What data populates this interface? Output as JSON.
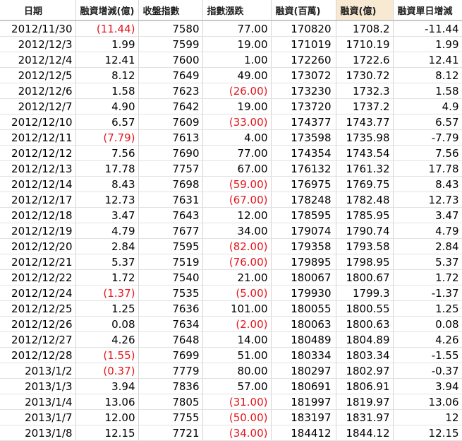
{
  "colors": {
    "negative": "#e4161c",
    "highlight_header": "#f7e9d2"
  },
  "table": {
    "headers": [
      "日期",
      "融資增減(億)",
      "收盤指數",
      "指數漲跌",
      "融資(百萬)",
      "融資(億)",
      "融資單日增減"
    ],
    "rows": [
      [
        "2012/11/30",
        "(11.44)",
        "7580",
        "77.00",
        "170820",
        "1708.2",
        "-11.44"
      ],
      [
        "2012/12/3",
        "1.99",
        "7599",
        "19.00",
        "171019",
        "1710.19",
        "1.99"
      ],
      [
        "2012/12/4",
        "12.41",
        "7600",
        "1.00",
        "172260",
        "1722.6",
        "12.41"
      ],
      [
        "2012/12/5",
        "8.12",
        "7649",
        "49.00",
        "173072",
        "1730.72",
        "8.12"
      ],
      [
        "2012/12/6",
        "1.58",
        "7623",
        "(26.00)",
        "173230",
        "1732.3",
        "1.58"
      ],
      [
        "2012/12/7",
        "4.90",
        "7642",
        "19.00",
        "173720",
        "1737.2",
        "4.9"
      ],
      [
        "2012/12/10",
        "6.57",
        "7609",
        "(33.00)",
        "174377",
        "1743.77",
        "6.57"
      ],
      [
        "2012/12/11",
        "(7.79)",
        "7613",
        "4.00",
        "173598",
        "1735.98",
        "-7.79"
      ],
      [
        "2012/12/12",
        "7.56",
        "7690",
        "77.00",
        "174354",
        "1743.54",
        "7.56"
      ],
      [
        "2012/12/13",
        "17.78",
        "7757",
        "67.00",
        "176132",
        "1761.32",
        "17.78"
      ],
      [
        "2012/12/14",
        "8.43",
        "7698",
        "(59.00)",
        "176975",
        "1769.75",
        "8.43"
      ],
      [
        "2012/12/17",
        "12.73",
        "7631",
        "(67.00)",
        "178248",
        "1782.48",
        "12.73"
      ],
      [
        "2012/12/18",
        "3.47",
        "7643",
        "12.00",
        "178595",
        "1785.95",
        "3.47"
      ],
      [
        "2012/12/19",
        "4.79",
        "7677",
        "34.00",
        "179074",
        "1790.74",
        "4.79"
      ],
      [
        "2012/12/20",
        "2.84",
        "7595",
        "(82.00)",
        "179358",
        "1793.58",
        "2.84"
      ],
      [
        "2012/12/21",
        "5.37",
        "7519",
        "(76.00)",
        "179895",
        "1798.95",
        "5.37"
      ],
      [
        "2012/12/22",
        "1.72",
        "7540",
        "21.00",
        "180067",
        "1800.67",
        "1.72"
      ],
      [
        "2012/12/24",
        "(1.37)",
        "7535",
        "(5.00)",
        "179930",
        "1799.3",
        "-1.37"
      ],
      [
        "2012/12/25",
        "1.25",
        "7636",
        "101.00",
        "180055",
        "1800.55",
        "1.25"
      ],
      [
        "2012/12/26",
        "0.08",
        "7634",
        "(2.00)",
        "180063",
        "1800.63",
        "0.08"
      ],
      [
        "2012/12/27",
        "4.26",
        "7648",
        "14.00",
        "180489",
        "1804.89",
        "4.26"
      ],
      [
        "2012/12/28",
        "(1.55)",
        "7699",
        "51.00",
        "180334",
        "1803.34",
        "-1.55"
      ],
      [
        "2013/1/2",
        "(0.37)",
        "7779",
        "80.00",
        "180297",
        "1802.97",
        "-0.37"
      ],
      [
        "2013/1/3",
        "3.94",
        "7836",
        "57.00",
        "180691",
        "1806.91",
        "3.94"
      ],
      [
        "2013/1/4",
        "13.06",
        "7805",
        "(31.00)",
        "181997",
        "1819.97",
        "13.06"
      ],
      [
        "2013/1/7",
        "12.00",
        "7755",
        "(50.00)",
        "183197",
        "1831.97",
        "12"
      ],
      [
        "2013/1/8",
        "12.15",
        "7721",
        "(34.00)",
        "184412",
        "1844.12",
        "12.15"
      ]
    ]
  }
}
